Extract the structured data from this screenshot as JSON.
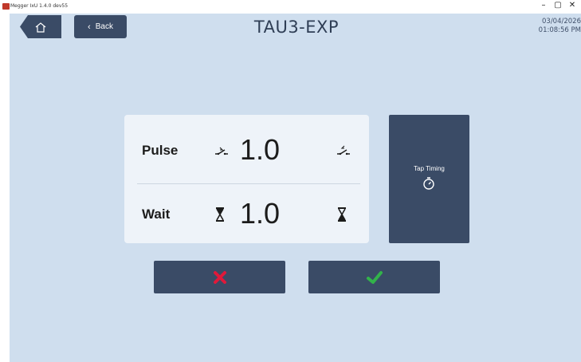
{
  "window": {
    "title": "Megger IxU 1.4.0 dev55",
    "minimize": "–",
    "maximize": "▢",
    "close": "✕"
  },
  "header": {
    "home_icon": "home-icon",
    "back_label": "Back",
    "title": "TAU3-EXP",
    "date": "03/04/2026",
    "time": "01:08:56 PM"
  },
  "settings": {
    "pulse": {
      "label": "Pulse",
      "value": "1.0",
      "decrease_icon": "switch-open-icon",
      "increase_icon": "switch-close-icon"
    },
    "wait": {
      "label": "Wait",
      "value": "1.0",
      "decrease_icon": "hourglass-empty-icon",
      "increase_icon": "hourglass-full-icon"
    }
  },
  "tap_timing": {
    "label": "Tap Timing",
    "icon": "stopwatch-icon"
  },
  "actions": {
    "cancel_icon": "x-icon",
    "confirm_icon": "check-icon"
  },
  "colors": {
    "background": "#cfdeee",
    "button": "#3a4b66",
    "card": "#eef3f9",
    "cancel": "#e0193a",
    "confirm": "#32b34a"
  }
}
